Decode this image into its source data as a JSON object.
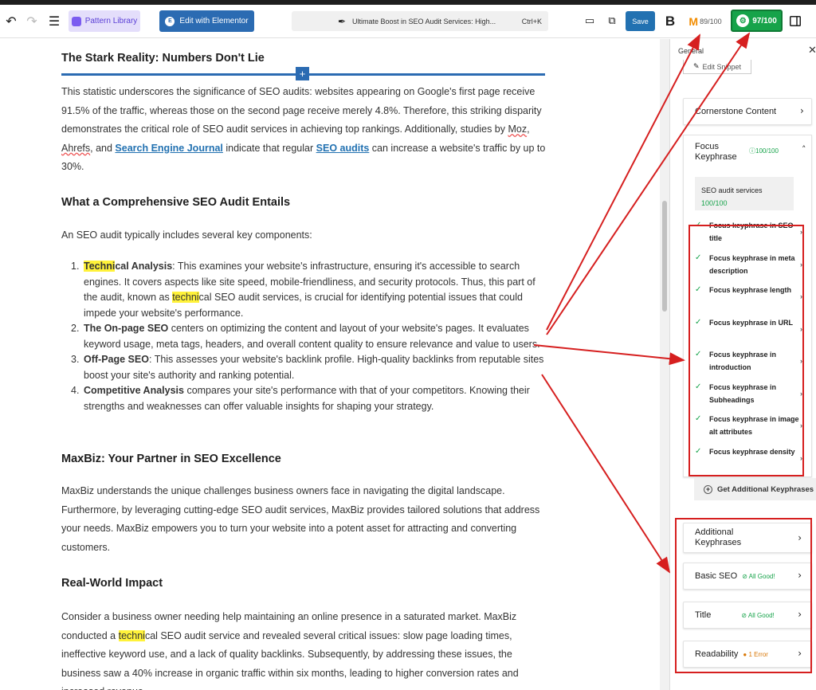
{
  "toolbar": {
    "undo_icon": "undo-icon",
    "redo_icon": "redo-icon",
    "list_view_icon": "list-view-icon",
    "pattern_library": "Pattern Library",
    "edit_elementor": "Edit with Elementor",
    "command_title": "Ultimate Boost in SEO Audit Services: High...",
    "command_shortcut": "Ctrl+K",
    "save": "Save",
    "b_logo": "B",
    "orange_score": "89/100",
    "green_score": "97/100"
  },
  "article": {
    "h_stark": "The Stark Reality: Numbers Don't Lie",
    "p1_a": "This statistic underscores the significance of SEO audits: websites appearing on Google's first page receive 91.5% of the traffic, whereas those on the second page receive merely 4.8%. Therefore, this striking disparity demonstrates the critical role of SEO audit services in achieving top rankings. Additionally, studies by ",
    "link_moz": "Moz",
    "sep1": ", ",
    "link_ahrefs": "Ahrefs",
    "sep2": ", and ",
    "link_sej": "Search Engine Journal",
    "p1_b": " indicate that regular ",
    "link_audits": "SEO audits",
    "p1_c": " can increase a website's traffic by up to 30%.",
    "h_comprehensive": "What a Comprehensive SEO Audit Entails",
    "p2": "An SEO audit typically includes several key components:",
    "list": [
      {
        "num": "1.",
        "hl": "Techni",
        "bold_rest": "cal Analysis",
        "text_a": ": This examines your website's infrastructure, ensuring it's accessible to search engines. It covers aspects like site speed, mobile-friendliness, and security protocols. Thus, this part of the audit, known as ",
        "hl2": "techni",
        "text_b": "cal SEO audit services, is crucial for identifying potential issues that could impede your website's performance."
      },
      {
        "num": "2.",
        "bold": "The On-page SEO",
        "text": " centers on optimizing the content and layout of your website's pages. It evaluates keyword usage, meta tags, headers, and overall content quality to ensure relevance and value to users."
      },
      {
        "num": "3.",
        "bold": "Off-Page SEO",
        "text": ": This assesses your website's backlink profile. High-quality backlinks from reputable sites boost your site's authority and ranking potential."
      },
      {
        "num": "4.",
        "bold": "Competitive Analysis",
        "text": " compares your site's performance with that of your competitors. Knowing their strengths and weaknesses can offer valuable insights for shaping your strategy."
      }
    ],
    "h_maxbiz": "MaxBiz: Your Partner in SEO Excellence",
    "p3": "MaxBiz understands the unique challenges business owners face in navigating the digital landscape. Furthermore, by leveraging cutting-edge SEO audit services, MaxBiz provides tailored solutions that address your needs. MaxBiz empowers you to turn your website into a potent asset for attracting and converting customers.",
    "h_impact": "Real-World Impact",
    "p4_a": "Consider a business owner needing help maintaining an online presence in a saturated market. MaxBiz conducted a ",
    "p4_hl": "techni",
    "p4_b": "cal SEO audit service and revealed several critical issues: slow page loading times, ineffective keyword use, and a lack of quality backlinks. Subsequently, by addressing these issues, the business saw a 40% increase in organic traffic within six months, leading to higher conversion rates and increased revenue."
  },
  "panel": {
    "header": "General",
    "edit_snippet": "Edit Snippet",
    "cornerstone": "Cornerstone Content",
    "focus_label": "Focus Keyphrase",
    "focus_score": "100/100",
    "keyword": "SEO audit services",
    "keyword_score": "100/100",
    "checks": [
      "Focus keyphrase in SEO title",
      "Focus keyphrase in meta description",
      "Focus keyphrase length",
      "Focus keyphrase in URL",
      "Focus keyphrase in introduction",
      "Focus keyphrase in Subheadings",
      "Focus keyphrase in image alt attributes",
      "Focus keyphrase density"
    ],
    "get_additional": "Get Additional Keyphrases",
    "additional": "Additional Keyphrases",
    "basic_seo": "Basic SEO",
    "basic_status": "All Good!",
    "title": "Title",
    "title_status": "All Good!",
    "readability": "Readability",
    "readability_status": "1 Error"
  },
  "colors": {
    "accent_blue": "#2271b1",
    "score_green": "#16a34a",
    "annotation_red": "#d61f1f",
    "highlight": "#fff23a"
  }
}
